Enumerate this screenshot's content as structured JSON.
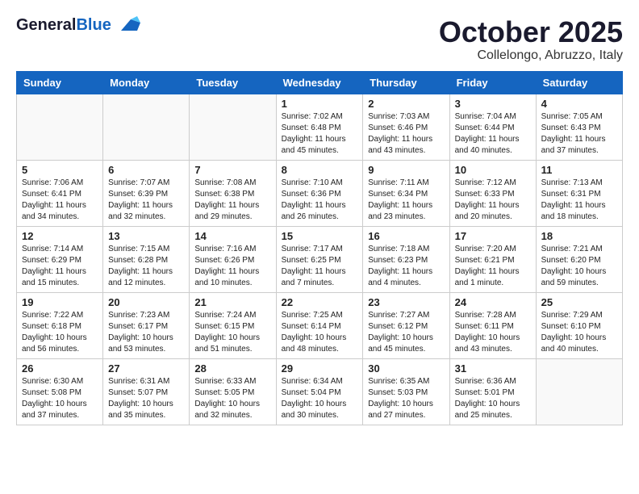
{
  "header": {
    "logo_general": "General",
    "logo_blue": "Blue",
    "title": "October 2025",
    "subtitle": "Collelongo, Abruzzo, Italy"
  },
  "calendar": {
    "weekdays": [
      "Sunday",
      "Monday",
      "Tuesday",
      "Wednesday",
      "Thursday",
      "Friday",
      "Saturday"
    ],
    "weeks": [
      [
        {
          "day": "",
          "info": ""
        },
        {
          "day": "",
          "info": ""
        },
        {
          "day": "",
          "info": ""
        },
        {
          "day": "1",
          "info": "Sunrise: 7:02 AM\nSunset: 6:48 PM\nDaylight: 11 hours and 45 minutes."
        },
        {
          "day": "2",
          "info": "Sunrise: 7:03 AM\nSunset: 6:46 PM\nDaylight: 11 hours and 43 minutes."
        },
        {
          "day": "3",
          "info": "Sunrise: 7:04 AM\nSunset: 6:44 PM\nDaylight: 11 hours and 40 minutes."
        },
        {
          "day": "4",
          "info": "Sunrise: 7:05 AM\nSunset: 6:43 PM\nDaylight: 11 hours and 37 minutes."
        }
      ],
      [
        {
          "day": "5",
          "info": "Sunrise: 7:06 AM\nSunset: 6:41 PM\nDaylight: 11 hours and 34 minutes."
        },
        {
          "day": "6",
          "info": "Sunrise: 7:07 AM\nSunset: 6:39 PM\nDaylight: 11 hours and 32 minutes."
        },
        {
          "day": "7",
          "info": "Sunrise: 7:08 AM\nSunset: 6:38 PM\nDaylight: 11 hours and 29 minutes."
        },
        {
          "day": "8",
          "info": "Sunrise: 7:10 AM\nSunset: 6:36 PM\nDaylight: 11 hours and 26 minutes."
        },
        {
          "day": "9",
          "info": "Sunrise: 7:11 AM\nSunset: 6:34 PM\nDaylight: 11 hours and 23 minutes."
        },
        {
          "day": "10",
          "info": "Sunrise: 7:12 AM\nSunset: 6:33 PM\nDaylight: 11 hours and 20 minutes."
        },
        {
          "day": "11",
          "info": "Sunrise: 7:13 AM\nSunset: 6:31 PM\nDaylight: 11 hours and 18 minutes."
        }
      ],
      [
        {
          "day": "12",
          "info": "Sunrise: 7:14 AM\nSunset: 6:29 PM\nDaylight: 11 hours and 15 minutes."
        },
        {
          "day": "13",
          "info": "Sunrise: 7:15 AM\nSunset: 6:28 PM\nDaylight: 11 hours and 12 minutes."
        },
        {
          "day": "14",
          "info": "Sunrise: 7:16 AM\nSunset: 6:26 PM\nDaylight: 11 hours and 10 minutes."
        },
        {
          "day": "15",
          "info": "Sunrise: 7:17 AM\nSunset: 6:25 PM\nDaylight: 11 hours and 7 minutes."
        },
        {
          "day": "16",
          "info": "Sunrise: 7:18 AM\nSunset: 6:23 PM\nDaylight: 11 hours and 4 minutes."
        },
        {
          "day": "17",
          "info": "Sunrise: 7:20 AM\nSunset: 6:21 PM\nDaylight: 11 hours and 1 minute."
        },
        {
          "day": "18",
          "info": "Sunrise: 7:21 AM\nSunset: 6:20 PM\nDaylight: 10 hours and 59 minutes."
        }
      ],
      [
        {
          "day": "19",
          "info": "Sunrise: 7:22 AM\nSunset: 6:18 PM\nDaylight: 10 hours and 56 minutes."
        },
        {
          "day": "20",
          "info": "Sunrise: 7:23 AM\nSunset: 6:17 PM\nDaylight: 10 hours and 53 minutes."
        },
        {
          "day": "21",
          "info": "Sunrise: 7:24 AM\nSunset: 6:15 PM\nDaylight: 10 hours and 51 minutes."
        },
        {
          "day": "22",
          "info": "Sunrise: 7:25 AM\nSunset: 6:14 PM\nDaylight: 10 hours and 48 minutes."
        },
        {
          "day": "23",
          "info": "Sunrise: 7:27 AM\nSunset: 6:12 PM\nDaylight: 10 hours and 45 minutes."
        },
        {
          "day": "24",
          "info": "Sunrise: 7:28 AM\nSunset: 6:11 PM\nDaylight: 10 hours and 43 minutes."
        },
        {
          "day": "25",
          "info": "Sunrise: 7:29 AM\nSunset: 6:10 PM\nDaylight: 10 hours and 40 minutes."
        }
      ],
      [
        {
          "day": "26",
          "info": "Sunrise: 6:30 AM\nSunset: 5:08 PM\nDaylight: 10 hours and 37 minutes."
        },
        {
          "day": "27",
          "info": "Sunrise: 6:31 AM\nSunset: 5:07 PM\nDaylight: 10 hours and 35 minutes."
        },
        {
          "day": "28",
          "info": "Sunrise: 6:33 AM\nSunset: 5:05 PM\nDaylight: 10 hours and 32 minutes."
        },
        {
          "day": "29",
          "info": "Sunrise: 6:34 AM\nSunset: 5:04 PM\nDaylight: 10 hours and 30 minutes."
        },
        {
          "day": "30",
          "info": "Sunrise: 6:35 AM\nSunset: 5:03 PM\nDaylight: 10 hours and 27 minutes."
        },
        {
          "day": "31",
          "info": "Sunrise: 6:36 AM\nSunset: 5:01 PM\nDaylight: 10 hours and 25 minutes."
        },
        {
          "day": "",
          "info": ""
        }
      ]
    ]
  }
}
